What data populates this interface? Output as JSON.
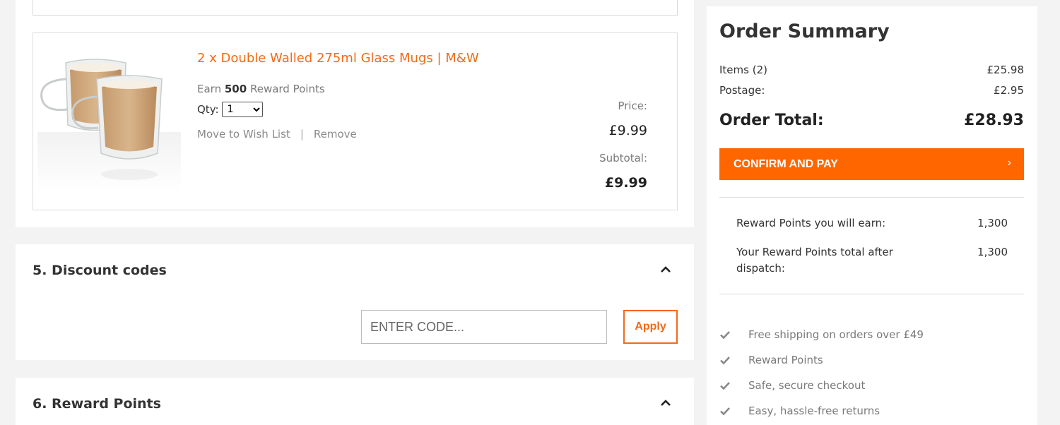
{
  "cart_item": {
    "title": "2 x Double Walled 275ml Glass Mugs | M&W",
    "earn_prefix": "Earn",
    "earn_points": "500",
    "earn_suffix": "Reward Points",
    "qty_label": "Qty:",
    "qty_value": "1",
    "move_to_wishlist": "Move to Wish List",
    "separator": "|",
    "remove": "Remove",
    "price_label": "Price:",
    "price_value": "£9.99",
    "subtotal_label": "Subtotal:",
    "subtotal_value": "£9.99"
  },
  "discount": {
    "title": "5. Discount codes",
    "placeholder": "ENTER CODE...",
    "apply_label": "Apply"
  },
  "reward_section": {
    "title": "6. Reward Points"
  },
  "summary": {
    "title": "Order Summary",
    "items_label": "Items (2)",
    "items_value": "£25.98",
    "postage_label": "Postage:",
    "postage_value": "£2.95",
    "total_label": "Order Total:",
    "total_value": "£28.93",
    "confirm_label": "CONFIRM AND PAY",
    "confirm_arrow": "›",
    "earn_label": "Reward Points you will earn:",
    "earn_value": "1,300",
    "after_label": "Your Reward Points total after dispatch:",
    "after_value": "1,300",
    "benefits": [
      "Free shipping on orders over £49",
      "Reward Points",
      "Safe, secure checkout",
      "Easy, hassle-free returns"
    ]
  },
  "colors": {
    "accent": "#ff6600",
    "link": "#f26a1b"
  }
}
